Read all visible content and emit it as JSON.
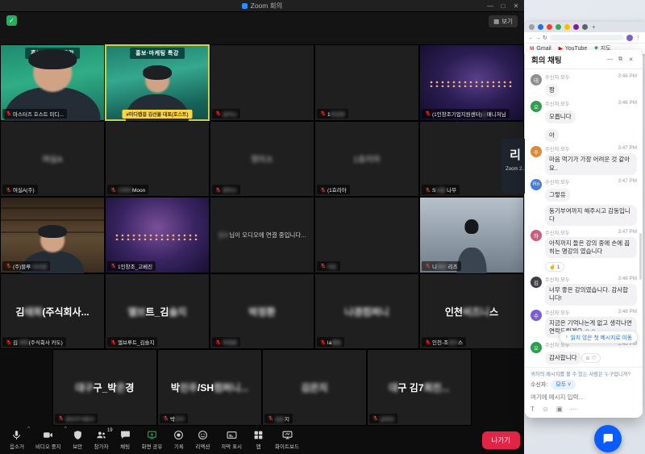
{
  "zoom": {
    "title": "Zoom 회의",
    "view_label": "보기",
    "window_controls": [
      "—",
      "□",
      "✕"
    ],
    "grid": {
      "rows": [
        [
          {
            "kind": "person-green",
            "banner_top": "홍보·마케팅 특강",
            "mic": "off",
            "label": [
              {
                "t": "마스터즈 호스트 미디...",
                "b": false
              }
            ]
          },
          {
            "kind": "speaker",
            "active": true,
            "banner_top": "홍보·마케팅 특강",
            "banner_bottom": "#미디랩걸 김선물 대표(호스트)"
          },
          {
            "kind": "dark",
            "mic": "off",
            "label": [
              {
                "t": "김이나",
                "b": true
              }
            ]
          },
          {
            "kind": "dark",
            "mic": "off",
            "label": [
              {
                "t": "1",
                "b": false
              },
              {
                "t": "박선영",
                "b": true
              }
            ]
          },
          {
            "kind": "city",
            "mic": "off",
            "label": [
              {
                "t": "(1인창조기업지원센터)",
                "b": false
              },
              {
                "t": "김",
                "b": true
              },
              {
                "t": "매니저님",
                "b": false
              }
            ]
          }
        ],
        [
          {
            "kind": "dark",
            "mic": "off",
            "center": [
              {
                "t": "여실A",
                "b": true
              }
            ],
            "label": [
              {
                "t": "여실A(주)",
                "b": false
              }
            ]
          },
          {
            "kind": "dark",
            "mic": "off",
            "label": [
              {
                "t": "스마트",
                "b": true
              },
              {
                "t": "Moon",
                "b": false
              }
            ]
          },
          {
            "kind": "dark",
            "mic": "off",
            "center": [
              {
                "t": "정미소",
                "b": true
              }
            ],
            "label": [
              {
                "t": "정미소",
                "b": true
              }
            ]
          },
          {
            "kind": "dark",
            "mic": "off",
            "center": [
              {
                "t": "1효리아",
                "b": true
              }
            ],
            "label": [
              {
                "t": "(1효리아",
                "b": false
              }
            ]
          },
          {
            "kind": "dark",
            "mic": "off",
            "label": [
              {
                "t": "S",
                "b": false
              },
              {
                "t": "서울",
                "b": true
              },
              {
                "t": " 나무",
                "b": false
              }
            ]
          }
        ],
        [
          {
            "kind": "desk-person",
            "mic": "off",
            "label": [
              {
                "t": "(주)블루",
                "b": false
              },
              {
                "t": "-이사장",
                "b": true
              }
            ]
          },
          {
            "kind": "night2",
            "mic": "off",
            "label": [
              {
                "t": "1인창조_고베진",
                "b": false
              }
            ]
          },
          {
            "kind": "dark",
            "notice": [
              {
                "t": "김수",
                "b": true
              },
              {
                "t": "님이 오디오에 연결 중입니다...",
                "b": false
              }
            ]
          },
          {
            "kind": "dark",
            "mic": "off",
            "label": [
              {
                "t": "이든",
                "b": true
              }
            ]
          },
          {
            "kind": "man-photo",
            "mic": "off",
            "label": [
              {
                "t": "니",
                "b": false
              },
              {
                "t": "체로",
                "b": true
              },
              {
                "t": " 리즈",
                "b": false
              }
            ]
          }
        ],
        [
          {
            "kind": "dark",
            "mic": "off",
            "big": [
              {
                "t": "김",
                "b": false
              },
              {
                "t": "태희",
                "b": true
              },
              {
                "t": "(주식회사...",
                "b": false
              }
            ],
            "label": [
              {
                "t": "김 ",
                "b": false
              },
              {
                "t": "태희",
                "b": true
              },
              {
                "t": "(주식회사 카도)",
                "b": false
              }
            ]
          },
          {
            "kind": "dark",
            "mic": "off",
            "big": [
              {
                "t": "엘브",
                "b": true
              },
              {
                "t": "트_김",
                "b": false
              },
              {
                "t": "슬지",
                "b": true
              }
            ],
            "label": [
              {
                "t": "엘브루트_김슬지",
                "b": false
              }
            ]
          },
          {
            "kind": "dark",
            "mic": "off",
            "big": [
              {
                "t": "박정환",
                "b": true
              }
            ],
            "label": [
              {
                "t": "박정환",
                "b": true
              }
            ]
          },
          {
            "kind": "dark",
            "mic": "off",
            "big": [
              {
                "t": "나겸컴퍼니",
                "b": true
              }
            ],
            "label": [
              {
                "t": "la",
                "b": false
              },
              {
                "t": "엠컴",
                "b": true
              }
            ]
          },
          {
            "kind": "dark",
            "mic": "off",
            "big": [
              {
                "t": "인천",
                "b": false
              },
              {
                "t": "비즈니",
                "b": true
              },
              {
                "t": "스",
                "b": false
              }
            ],
            "label": [
              {
                "t": "인천-조",
                "b": false
              },
              {
                "t": "경수",
                "b": true
              },
              {
                "t": "스",
                "b": false
              }
            ]
          }
        ],
        [
          {
            "kind": "dark",
            "mic": "off",
            "big": [
              {
                "t": "대구",
                "b": true
              },
              {
                "t": "구_박",
                "b": false
              },
              {
                "t": "은",
                "b": true
              },
              {
                "t": "경",
                "b": false
              }
            ],
            "label": [
              {
                "t": "큐브주식회사",
                "b": true
              }
            ]
          },
          {
            "kind": "dark",
            "mic": "off",
            "big": [
              {
                "t": "박",
                "b": false
              },
              {
                "t": "민주",
                "b": true
              },
              {
                "t": "/SH",
                "b": false
              },
              {
                "t": "컴퍼니...",
                "b": true
              }
            ],
            "label": [
              {
                "t": "박",
                "b": false
              },
              {
                "t": "민주",
                "b": true
              }
            ]
          },
          {
            "kind": "dark",
            "mic": "off",
            "big": [
              {
                "t": "김은지",
                "b": true
              }
            ],
            "label": [
              {
                "t": "김은",
                "b": true
              },
              {
                "t": "지",
                "b": false
              }
            ]
          },
          {
            "kind": "dark",
            "mic": "off",
            "big": [
              {
                "t": "대",
                "b": true
              },
              {
                "t": "구 김7",
                "b": false
              },
              {
                "t": "희진...",
                "b": true
              }
            ],
            "label": [
              {
                "t": "김희진",
                "b": true
              }
            ]
          }
        ]
      ]
    },
    "toolbar": {
      "buttons": [
        {
          "id": "mute",
          "icon": "mic",
          "label": "음소거",
          "chevron": true
        },
        {
          "id": "stop-video",
          "icon": "video",
          "label": "비디오 중지",
          "chevron": true
        },
        {
          "id": "security",
          "icon": "shield",
          "label": "보안"
        },
        {
          "id": "participants",
          "icon": "people",
          "label": "참가자",
          "badge": "19"
        },
        {
          "id": "chat",
          "icon": "chat",
          "label": "채팅"
        },
        {
          "id": "share-screen",
          "icon": "share",
          "label": "화면 공유",
          "accent": true
        },
        {
          "id": "record",
          "icon": "record",
          "label": "기록"
        },
        {
          "id": "reactions",
          "icon": "react",
          "label": "리액션"
        },
        {
          "id": "captions",
          "icon": "caption",
          "label": "자막 표시"
        },
        {
          "id": "apps",
          "icon": "apps",
          "label": "앱"
        },
        {
          "id": "whiteboard",
          "icon": "board",
          "label": "화이트보드"
        }
      ],
      "leave_label": "나가기"
    }
  },
  "browser": {
    "tab_colors": [
      "#9aa0a6",
      "#1a73e8",
      "#ea4335",
      "#34a853",
      "#fbbc05",
      "#7b1fa2",
      "#5f6368"
    ],
    "new_tab_glyph": "+",
    "nav_glyphs": [
      "←",
      "→",
      "↻"
    ],
    "menu_glyph": "⋮",
    "bookmarks": [
      {
        "icon": "M",
        "color": "#ea4335",
        "label": "Gmail"
      },
      {
        "icon": "▶",
        "color": "#ff0000",
        "label": "YouTube"
      },
      {
        "icon": "⬥",
        "color": "#34a853",
        "label": "지도"
      }
    ]
  },
  "hidden_window": {
    "big": "리",
    "small": "Zoom 2.."
  },
  "chat": {
    "title": "회의 채팅",
    "controls": [
      "—",
      "⧉",
      "✕"
    ],
    "messages": [
      {
        "avatar": "테",
        "avatar_color": "#8e8e93",
        "meta": "수신자:모두",
        "time": "3:46 PM",
        "text": "짱"
      },
      {
        "avatar": "오",
        "avatar_color": "#2e9e4f",
        "meta": "수신자:모두",
        "time": "3:46 PM",
        "text": "모릅니다"
      },
      {
        "text": "아"
      },
      {
        "avatar": "수",
        "avatar_color": "#d98a3d",
        "meta": "수신자:모두",
        "time": "3:47 PM",
        "text": "마음 먹기가 가장 어려운 것 같아요.."
      },
      {
        "avatar": "Rn",
        "avatar_color": "#4a7dd4",
        "meta": "수신자:모두",
        "time": "3:47 PM",
        "text": "그렇유"
      },
      {
        "text": "동기부여까지 해주시고 감동입니다"
      },
      {
        "avatar": "하",
        "avatar_color": "#c95f7b",
        "meta": "수신자:모두",
        "time": "3:47 PM",
        "text": "아직까지 들은 강의 중에 손에 꼽히는 명강의 였습니다",
        "reaction": "☝ 1"
      },
      {
        "avatar": "김",
        "avatar_color": "#3d3f45",
        "meta": "수신자:모두",
        "time": "3:48 PM",
        "text": "너무 좋은 강의였습니다. 감사합니다!"
      },
      {
        "avatar": "수",
        "avatar_color": "#7a5fd4",
        "meta": "수신자:모두",
        "time": "3:48 PM",
        "text": "지금은 기억나는게 없고 생각나면 연락드릴게요 ☺☺"
      },
      {
        "avatar": "오",
        "avatar_color": "#2e9e4f",
        "meta": "수신자:모두",
        "time": "3:48 PM",
        "text": "감사합니다",
        "reaction": "☺ ♡"
      }
    ],
    "unread_tooltip": "읽지 않은 첫 메시지로 이동",
    "unread_arrow": "↑",
    "privacy_note": "귀하의 메시지를 볼 수 있는 사람은 누구입니까?",
    "recipient_label": "수신자:",
    "recipient_value": "모두",
    "recipient_caret": "˅",
    "input_placeholder": "여기에 메시지 입력...",
    "composer_icons": [
      "T",
      "☺",
      "▣",
      "⋯"
    ]
  }
}
